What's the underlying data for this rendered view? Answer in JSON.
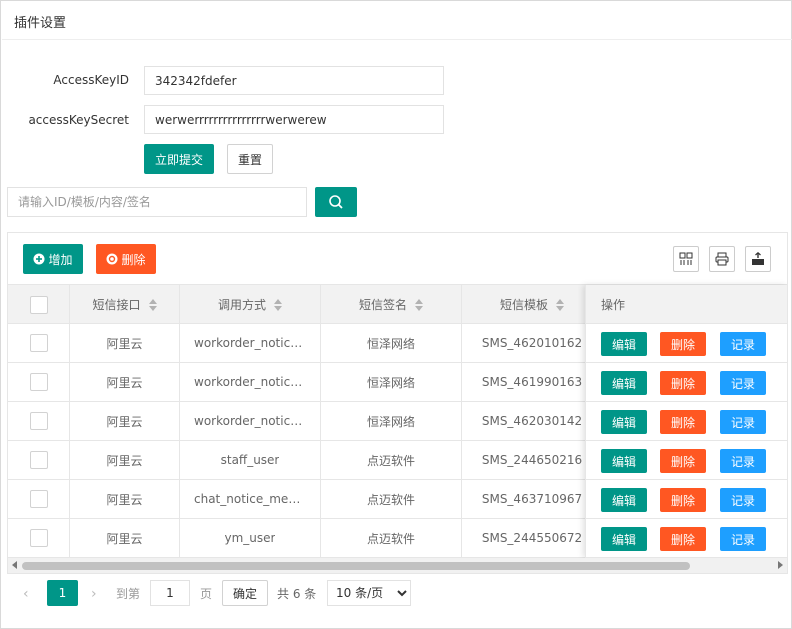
{
  "header": {
    "title": "插件设置"
  },
  "form": {
    "access_key_id_label": "AccessKeyID",
    "access_key_id_value": "342342fdefer",
    "access_key_secret_label": "accessKeySecret",
    "access_key_secret_value": "werwerrrrrrrrrrrrrrrwerwerew",
    "submit_label": "立即提交",
    "reset_label": "重置"
  },
  "search": {
    "placeholder": "请输入ID/模板/内容/签名",
    "icon": "search-icon"
  },
  "toolbar": {
    "add_label": "增加",
    "delete_label": "删除",
    "icons": [
      "columns-icon",
      "print-icon",
      "export-icon"
    ]
  },
  "table": {
    "headers": {
      "channel": "短信接口",
      "call_method": "调用方式",
      "sign": "短信签名",
      "template": "短信模板",
      "ops": "操作"
    },
    "rows": [
      {
        "channel": "阿里云",
        "call_method": "workorder_notice_change",
        "sign": "恒泽网络",
        "template": "SMS_462010162"
      },
      {
        "channel": "阿里云",
        "call_method": "workorder_notice_create",
        "sign": "恒泽网络",
        "template": "SMS_461990163"
      },
      {
        "channel": "阿里云",
        "call_method": "workorder_notice_handle",
        "sign": "恒泽网络",
        "template": "SMS_462030142"
      },
      {
        "channel": "阿里云",
        "call_method": "staff_user",
        "sign": "点迈软件",
        "template": "SMS_244650216"
      },
      {
        "channel": "阿里云",
        "call_method": "chat_notice_message",
        "sign": "点迈软件",
        "template": "SMS_463710967"
      },
      {
        "channel": "阿里云",
        "call_method": "ym_user",
        "sign": "点迈软件",
        "template": "SMS_244550672"
      }
    ],
    "row_actions": {
      "edit": "编辑",
      "delete": "删除",
      "log": "记录"
    }
  },
  "pager": {
    "current": "1",
    "goto_label": "到第",
    "goto_value": "1",
    "page_label": "页",
    "confirm_label": "确定",
    "total_label": "共 6 条",
    "page_size_option": "10 条/页"
  },
  "colors": {
    "primary": "#009688",
    "danger": "#ff5722",
    "blue": "#1e9fff"
  }
}
